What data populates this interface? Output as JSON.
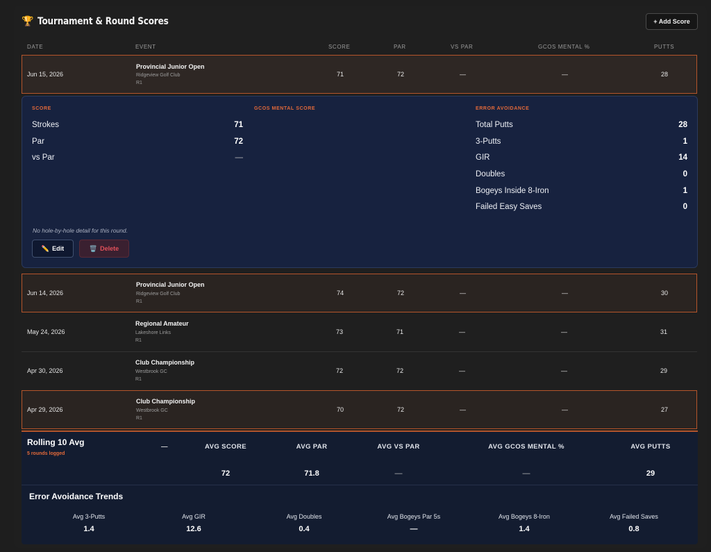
{
  "header": {
    "title": "Tournament & Round Scores",
    "add_button": "+ Add Score"
  },
  "columns": [
    "DATE",
    "EVENT",
    "SCORE",
    "PAR",
    "VS PAR",
    "GCOS MENTAL %",
    "PUTTS"
  ],
  "rows": [
    {
      "date": "Jun 15, 2026",
      "event": "Provincial Junior Open",
      "club": "Ridgeview Golf Club",
      "round": "R1",
      "score": "71",
      "par": "72",
      "vs_par": "—",
      "gcos": "—",
      "putts": "28"
    },
    {
      "date": "Jun 14, 2026",
      "event": "Provincial Junior Open",
      "club": "Ridgeview Golf Club",
      "round": "R1",
      "score": "74",
      "par": "72",
      "vs_par": "—",
      "gcos": "—",
      "putts": "30"
    },
    {
      "date": "May 24, 2026",
      "event": "Regional Amateur",
      "club": "Lakeshore Links",
      "round": "R1",
      "score": "73",
      "par": "71",
      "vs_par": "—",
      "gcos": "—",
      "putts": "31"
    },
    {
      "date": "Apr 30, 2026",
      "event": "Club Championship",
      "club": "Westbrook GC",
      "round": "R1",
      "score": "72",
      "par": "72",
      "vs_par": "—",
      "gcos": "—",
      "putts": "29"
    },
    {
      "date": "Apr 29, 2026",
      "event": "Club Championship",
      "club": "Westbrook GC",
      "round": "R1",
      "score": "70",
      "par": "72",
      "vs_par": "—",
      "gcos": "—",
      "putts": "27"
    }
  ],
  "detail": {
    "score_heading": "SCORE",
    "gcos_heading": "GCOS MENTAL SCORE",
    "error_heading": "ERROR AVOIDANCE",
    "score_items": [
      {
        "label": "Strokes",
        "value": "71"
      },
      {
        "label": "Par",
        "value": "72"
      },
      {
        "label": "vs Par",
        "value": "—"
      }
    ],
    "error_items": [
      {
        "label": "Total Putts",
        "value": "28"
      },
      {
        "label": "3-Putts",
        "value": "1"
      },
      {
        "label": "GIR",
        "value": "14"
      },
      {
        "label": "Doubles",
        "value": "0"
      },
      {
        "label": "Bogeys Inside 8-Iron",
        "value": "1"
      },
      {
        "label": "Failed Easy Saves",
        "value": "0"
      }
    ],
    "note": "No hole-by-hole detail for this round.",
    "edit_label": "Edit",
    "delete_label": "Delete"
  },
  "rolling": {
    "title": "Rolling 10 Avg",
    "subtitle": "5 rounds logged",
    "lead_dash": "—",
    "headers": [
      "AVG SCORE",
      "AVG PAR",
      "AVG VS PAR",
      "AVG GCOS MENTAL %",
      "AVG PUTTS"
    ],
    "values": [
      "72",
      "71.8",
      "—",
      "—",
      "29"
    ]
  },
  "trends": {
    "title": "Error Avoidance Trends",
    "items": [
      {
        "label": "Avg 3-Putts",
        "value": "1.4"
      },
      {
        "label": "Avg GIR",
        "value": "12.6"
      },
      {
        "label": "Avg Doubles",
        "value": "0.4"
      },
      {
        "label": "Avg Bogeys Par 5s",
        "value": "—"
      },
      {
        "label": "Avg Bogeys 8-Iron",
        "value": "1.4"
      },
      {
        "label": "Avg Failed Saves",
        "value": "0.8"
      }
    ]
  },
  "colors": {
    "accent": "#e2693a",
    "highlight_border": "#b5552b",
    "detail_bg": "#17223f",
    "rolling_bg": "#131c30"
  },
  "icons": {
    "title": "trophy-icon",
    "edit": "pencil-icon",
    "delete": "trash-icon"
  }
}
